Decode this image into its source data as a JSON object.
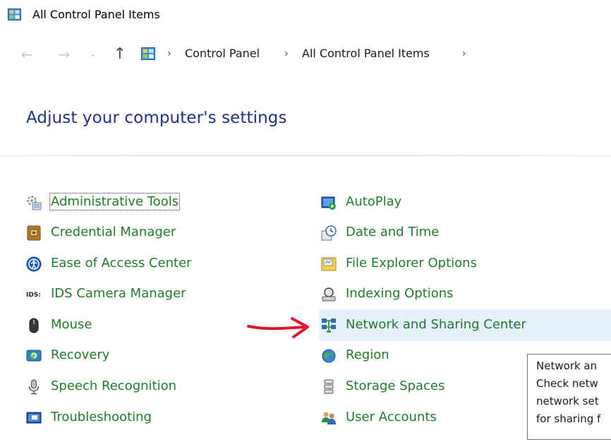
{
  "window": {
    "title": "All Control Panel Items"
  },
  "address_bar": {
    "crumbs": [
      "Control Panel",
      "All Control Panel Items"
    ]
  },
  "page": {
    "heading": "Adjust your computer's settings"
  },
  "items": {
    "left": [
      {
        "label": "Administrative Tools",
        "icon": "admin-tools-icon"
      },
      {
        "label": "Credential Manager",
        "icon": "credential-manager-icon"
      },
      {
        "label": "Ease of Access Center",
        "icon": "ease-of-access-icon"
      },
      {
        "label": "IDS Camera Manager",
        "icon": "ids-icon"
      },
      {
        "label": "Mouse",
        "icon": "mouse-icon"
      },
      {
        "label": "Recovery",
        "icon": "recovery-icon"
      },
      {
        "label": "Speech Recognition",
        "icon": "microphone-icon"
      },
      {
        "label": "Troubleshooting",
        "icon": "troubleshooting-icon"
      }
    ],
    "right": [
      {
        "label": "AutoPlay",
        "icon": "autoplay-icon"
      },
      {
        "label": "Date and Time",
        "icon": "clock-icon"
      },
      {
        "label": "File Explorer Options",
        "icon": "folder-options-icon"
      },
      {
        "label": "Indexing Options",
        "icon": "indexing-icon"
      },
      {
        "label": "Network and Sharing Center",
        "icon": "network-icon"
      },
      {
        "label": "Region",
        "icon": "globe-icon"
      },
      {
        "label": "Storage Spaces",
        "icon": "storage-icon"
      },
      {
        "label": "User Accounts",
        "icon": "users-icon"
      }
    ]
  },
  "tooltip": {
    "lines": [
      "Network an",
      "Check netw",
      "network set",
      "for sharing f"
    ]
  },
  "colors": {
    "link_green": "#217a2b",
    "heading_blue": "#1e3287",
    "highlight": "#e5f1fb",
    "annotation_red": "#e0162b"
  }
}
